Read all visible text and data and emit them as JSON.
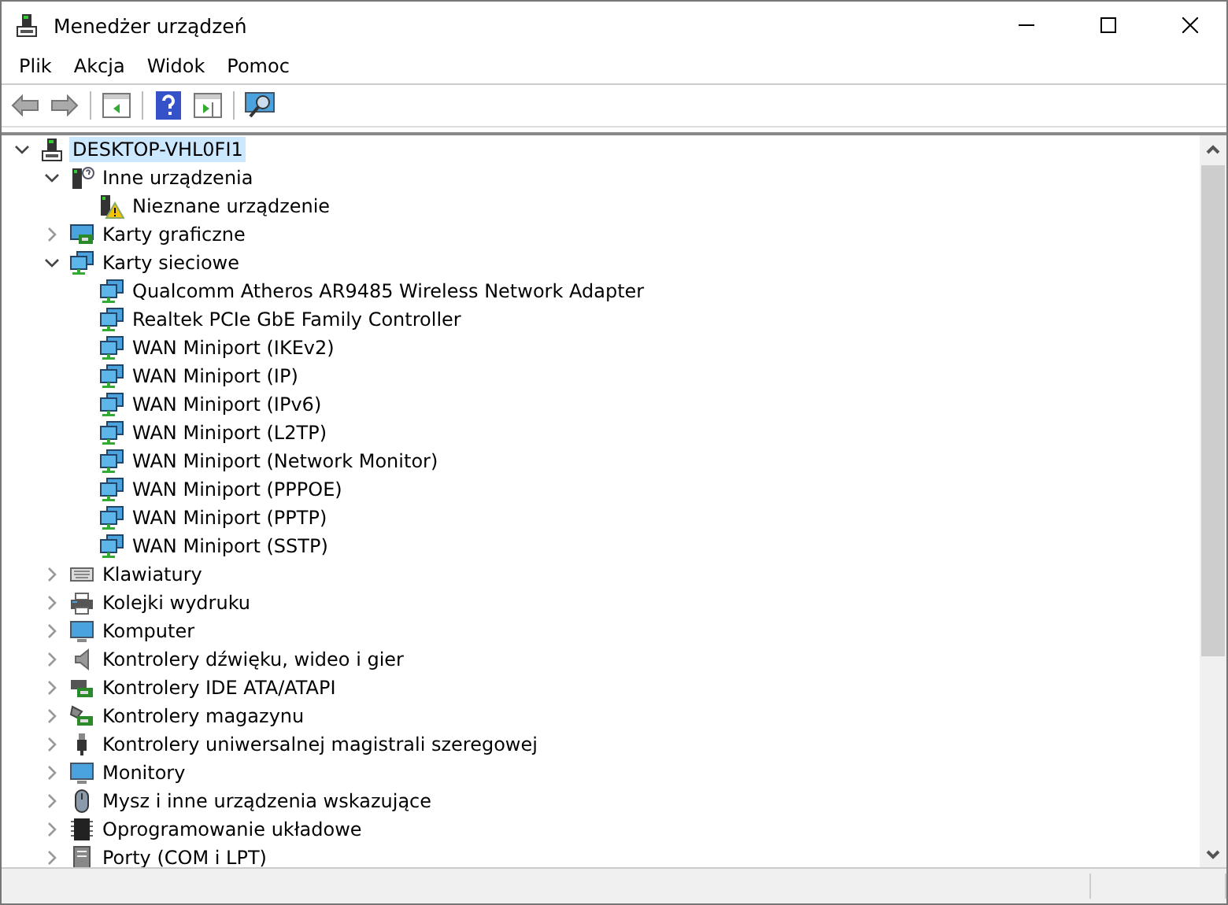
{
  "window": {
    "title": "Menedżer urządzeń"
  },
  "menu": [
    "Plik",
    "Akcja",
    "Widok",
    "Pomoc"
  ],
  "tree": [
    {
      "label": "DESKTOP-VHL0FI1",
      "kind": "computer",
      "expanded": true,
      "selected": true,
      "children": [
        {
          "label": "Inne urządzenia",
          "kind": "unknown",
          "expanded": true,
          "selected": false,
          "children": [
            {
              "label": "Nieznane urządzenie",
              "kind": "warning",
              "selected": false
            }
          ]
        },
        {
          "label": "Karty graficzne",
          "kind": "display",
          "expanded": false,
          "selected": false
        },
        {
          "label": "Karty sieciowe",
          "kind": "network",
          "expanded": true,
          "selected": false,
          "children": [
            {
              "label": "Qualcomm Atheros AR9485 Wireless Network Adapter",
              "kind": "network",
              "selected": false
            },
            {
              "label": "Realtek PCIe GbE Family Controller",
              "kind": "network",
              "selected": false
            },
            {
              "label": "WAN Miniport (IKEv2)",
              "kind": "network",
              "selected": false
            },
            {
              "label": "WAN Miniport (IP)",
              "kind": "network",
              "selected": false
            },
            {
              "label": "WAN Miniport (IPv6)",
              "kind": "network",
              "selected": false
            },
            {
              "label": "WAN Miniport (L2TP)",
              "kind": "network",
              "selected": false
            },
            {
              "label": "WAN Miniport (Network Monitor)",
              "kind": "network",
              "selected": false
            },
            {
              "label": "WAN Miniport (PPPOE)",
              "kind": "network",
              "selected": false
            },
            {
              "label": "WAN Miniport (PPTP)",
              "kind": "network",
              "selected": false
            },
            {
              "label": "WAN Miniport (SSTP)",
              "kind": "network",
              "selected": false
            }
          ]
        },
        {
          "label": "Klawiatury",
          "kind": "keyboard",
          "expanded": false,
          "selected": false
        },
        {
          "label": "Kolejki wydruku",
          "kind": "printer",
          "expanded": false,
          "selected": false
        },
        {
          "label": "Komputer",
          "kind": "monitor",
          "expanded": false,
          "selected": false
        },
        {
          "label": "Kontrolery dźwięku, wideo i gier",
          "kind": "speaker",
          "expanded": false,
          "selected": false
        },
        {
          "label": "Kontrolery IDE ATA/ATAPI",
          "kind": "card",
          "expanded": false,
          "selected": false
        },
        {
          "label": "Kontrolery magazynu",
          "kind": "storage",
          "expanded": false,
          "selected": false
        },
        {
          "label": "Kontrolery uniwersalnej magistrali szeregowej",
          "kind": "usb",
          "expanded": false,
          "selected": false
        },
        {
          "label": "Monitory",
          "kind": "monitor",
          "expanded": false,
          "selected": false
        },
        {
          "label": "Mysz i inne urządzenia wskazujące",
          "kind": "mouse",
          "expanded": false,
          "selected": false
        },
        {
          "label": "Oprogramowanie układowe",
          "kind": "chip",
          "expanded": false,
          "selected": false
        },
        {
          "label": "Porty (COM i LPT)",
          "kind": "port",
          "expanded": false,
          "selected": false
        }
      ]
    }
  ]
}
